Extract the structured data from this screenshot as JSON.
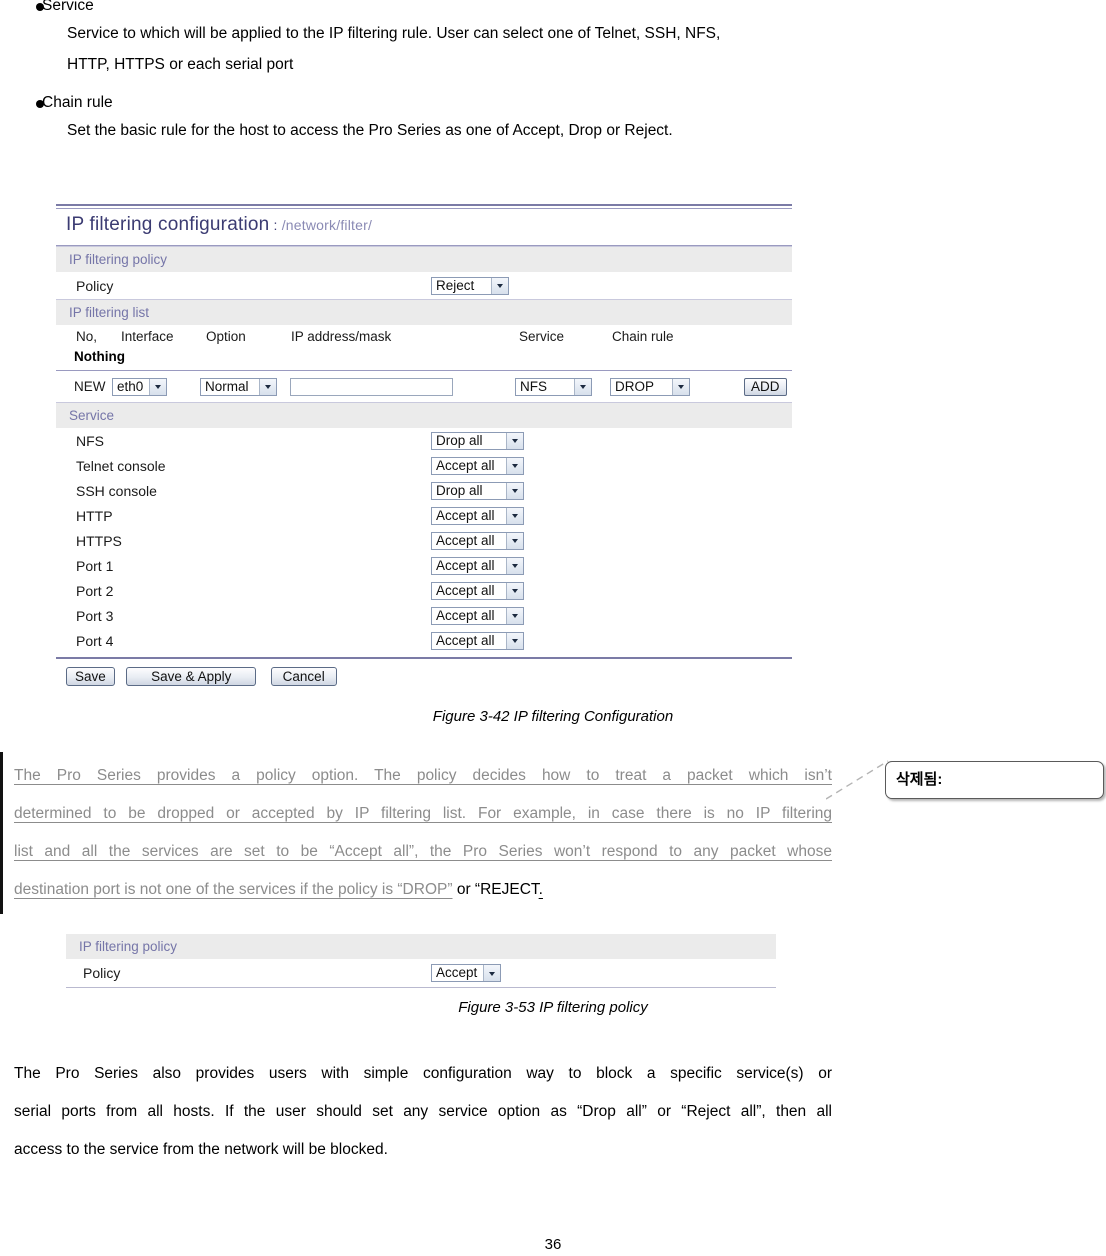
{
  "page": {
    "number": "36"
  },
  "bullets": [
    {
      "label": "Service",
      "body_line1": "Service to which will be applied to the IP filtering rule. User can select one of Telnet, SSH, NFS,",
      "body_line2": "HTTP, HTTPS or each serial port"
    },
    {
      "label": "Chain rule",
      "body_line1": "Set the basic rule for the host to access the Pro Series as one of Accept, Drop or Reject.",
      "body_line2": ""
    }
  ],
  "figure1": {
    "title": "IP filtering configuration",
    "title_sep": " : ",
    "crumb_slash1": "/",
    "crumb_part1": "network",
    "crumb_slash2": "/",
    "crumb_part2": "filter",
    "crumb_slash3": "/",
    "section_policy": "IP filtering policy",
    "policy_label": "Policy",
    "policy_value": "Reject",
    "section_list": "IP filtering list",
    "table_headers": [
      "No,",
      "Interface",
      "Option",
      "IP address/mask",
      "Service",
      "Chain rule"
    ],
    "empty_text": "Nothing",
    "new_row": {
      "no": "NEW",
      "interface": "eth0",
      "option": "Normal",
      "address": "",
      "service": "NFS",
      "chain_rule": "DROP",
      "add_button": "ADD"
    },
    "section_service": "Service",
    "services": [
      {
        "name": "NFS",
        "action": "Drop all"
      },
      {
        "name": "Telnet console",
        "action": "Accept all"
      },
      {
        "name": "SSH console",
        "action": "Drop all"
      },
      {
        "name": "HTTP",
        "action": "Accept all"
      },
      {
        "name": "HTTPS",
        "action": "Accept all"
      },
      {
        "name": "Port 1",
        "action": "Accept all"
      },
      {
        "name": "Port 2",
        "action": "Accept all"
      },
      {
        "name": "Port 3",
        "action": "Accept all"
      },
      {
        "name": "Port 4",
        "action": "Accept all"
      }
    ],
    "buttons": {
      "save": "Save",
      "save_apply": "Save & Apply",
      "cancel": "Cancel"
    },
    "caption": "Figure 3-42 IP filtering Configuration"
  },
  "tracked_paragraph": {
    "line1_ins": "The  Pro  Series  provides  a  policy  option.  The  policy  decides  how  to  treat  a  packet  which  isn’t",
    "line2_ins": "determined to be dropped or accepted by IP filtering list. For example, in case there is no IP filtering",
    "line3_ins": "list and all the services are set to be “Accept all”, the Pro Series won’t respond to any packet whose",
    "line4_ins": "destination port is not one of the services if the policy is “DROP”",
    "line4_kept": " or “REJECT",
    "line4_kept_u": ". "
  },
  "comment": {
    "label": "삭제됨:"
  },
  "figure2": {
    "section_policy": "IP filtering policy",
    "policy_label": "Policy",
    "policy_value": "Accept",
    "caption": "Figure 3-53 IP filtering policy"
  },
  "closing_paragraph": {
    "line1": "The  Pro  Series  also  provides  users  with  simple  configuration  way  to  block  a  specific  service(s)  or",
    "line2": "serial ports from all hosts. If the user should set any service option as “Drop all” or “Reject all”, then all",
    "line3": "access to the service from the network will be blocked."
  },
  "colors": {
    "title": "#3b3b72",
    "crumb": "#8a8ab4",
    "band_bg": "#ebebeb",
    "band_text": "#7575a8",
    "rule": "#7b7ba6",
    "tracked_text": "#8c8c8c"
  }
}
